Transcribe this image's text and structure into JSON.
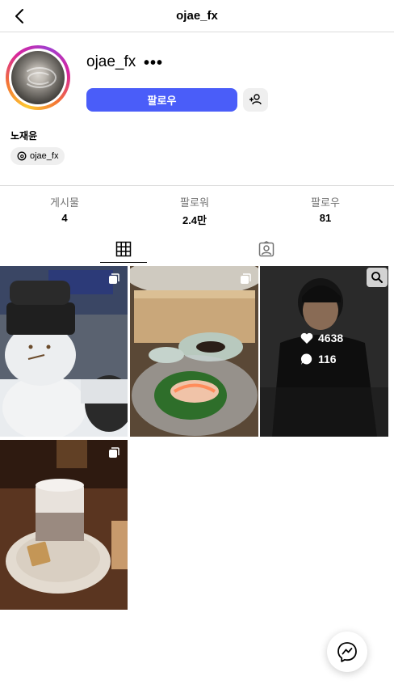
{
  "header": {
    "title": "ojae_fx"
  },
  "profile": {
    "username": "ojae_fx",
    "more": "•••",
    "follow_label": "팔로우",
    "full_name": "노재윤",
    "threads_handle": "ojae_fx"
  },
  "stats": [
    {
      "label": "게시물",
      "value": "4"
    },
    {
      "label": "팔로워",
      "value": "2.4만"
    },
    {
      "label": "팔로우",
      "value": "81"
    }
  ],
  "posts": [
    {
      "subject": "snowman with hat",
      "multi": true
    },
    {
      "subject": "sashimi dish",
      "multi": true
    },
    {
      "subject": "portrait",
      "likes": "4638",
      "comments": "116"
    },
    {
      "subject": "cup on saucer with cookie",
      "multi": true
    }
  ]
}
